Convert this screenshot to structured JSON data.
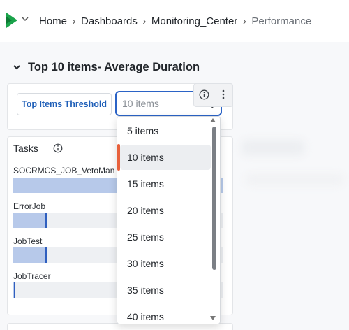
{
  "breadcrumb": {
    "items": [
      "Home",
      "Dashboards",
      "Monitoring_Center",
      "Performance"
    ],
    "separator": "›"
  },
  "section": {
    "title": "Top 10 items- Average Duration"
  },
  "filter": {
    "threshold_button_label": "Top Items Threshold",
    "select_placeholder": "10 items"
  },
  "tasks": {
    "title": "Tasks",
    "rows": [
      {
        "label": "SOCRMCS_JOB_VetoMan",
        "fill_fraction": 1.0
      },
      {
        "label": "ErrorJob",
        "fill_fraction": 0.16
      },
      {
        "label": "JobTest",
        "fill_fraction": 0.16
      },
      {
        "label": "JobTracer",
        "fill_fraction": 0.01
      }
    ]
  },
  "dropdown": {
    "options": [
      "5 items",
      "10 items",
      "15 items",
      "20 items",
      "25 items",
      "30 items",
      "35 items",
      "40 items"
    ],
    "selected_index": 1
  },
  "colors": {
    "accent": "#2b63c6",
    "brand": "#1aa34a",
    "selected_marker": "#e8613c",
    "bar_fill": "#b7c9ea"
  },
  "icons": {
    "logo": "brand-logo-icon",
    "info": "info-icon",
    "more": "more-vertical-icon",
    "search": "search-icon",
    "collapse": "chevron-down-icon"
  }
}
